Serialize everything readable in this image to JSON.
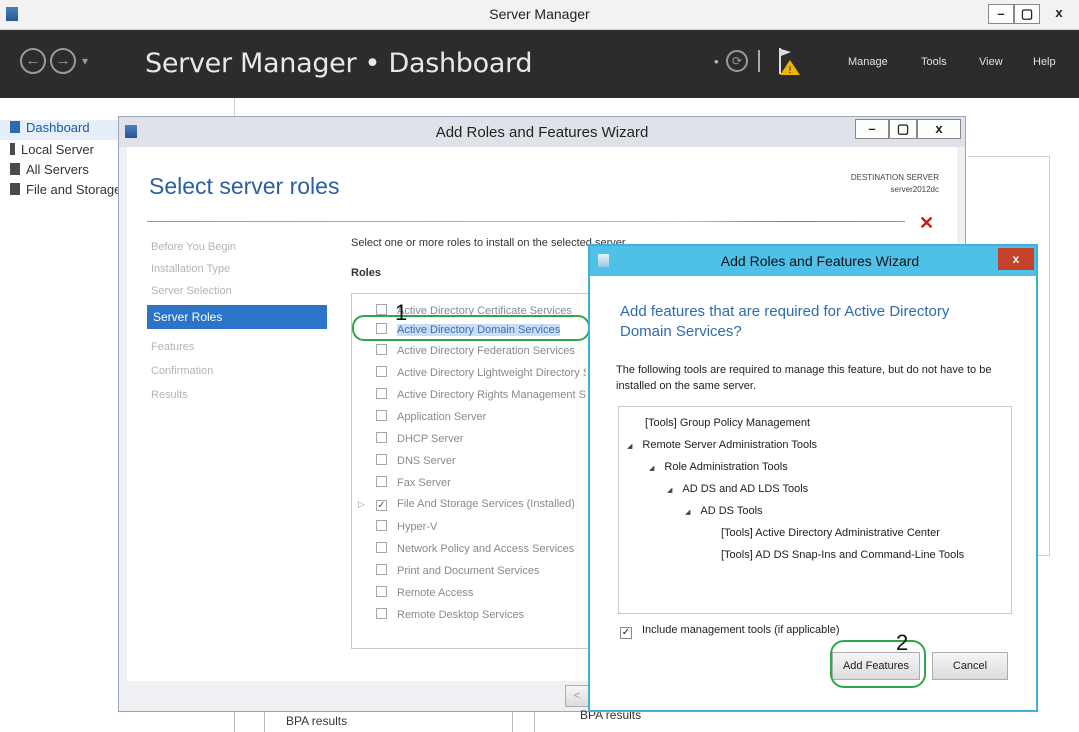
{
  "window": {
    "title": "Server Manager",
    "controls": [
      "–",
      "▢",
      "x"
    ]
  },
  "header": {
    "breadcrumb": "Server Manager • Dashboard",
    "menu": [
      "Manage",
      "Tools",
      "View",
      "Help"
    ]
  },
  "sidebar": {
    "items": [
      {
        "label": "Dashboard"
      },
      {
        "label": "Local Server"
      },
      {
        "label": "All Servers"
      },
      {
        "label": "File and Storage Services"
      }
    ]
  },
  "wizard": {
    "title": "Add Roles and Features Wizard",
    "controls": [
      "–",
      "▢",
      "x"
    ],
    "heading": "Select server roles",
    "destination_label": "DESTINATION SERVER",
    "destination_server": "server2012dc",
    "steps": [
      "Before You Begin",
      "Installation Type",
      "Server Selection",
      "Server Roles",
      "Features",
      "Confirmation",
      "Results"
    ],
    "active_step": "Server Roles",
    "instruction": "Select one or more roles to install on the selected server.",
    "roles_header": "Roles",
    "roles": [
      {
        "label": "Active Directory Certificate Services",
        "checked": false
      },
      {
        "label": "Active Directory Domain Services",
        "checked": false,
        "selected": true
      },
      {
        "label": "Active Directory Federation Services",
        "checked": false
      },
      {
        "label": "Active Directory Lightweight Directory Services",
        "checked": false
      },
      {
        "label": "Active Directory Rights Management Services",
        "checked": false
      },
      {
        "label": "Application Server",
        "checked": false
      },
      {
        "label": "DHCP Server",
        "checked": false
      },
      {
        "label": "DNS Server",
        "checked": false
      },
      {
        "label": "Fax Server",
        "checked": false
      },
      {
        "label": "File And Storage Services (Installed)",
        "checked": true,
        "expandable": true
      },
      {
        "label": "Hyper-V",
        "checked": false
      },
      {
        "label": "Network Policy and Access Services",
        "checked": false
      },
      {
        "label": "Print and Document Services",
        "checked": false
      },
      {
        "label": "Remote Access",
        "checked": false
      },
      {
        "label": "Remote Desktop Services",
        "checked": false
      }
    ],
    "footer_prev": "<"
  },
  "dialog": {
    "title": "Add Roles and Features Wizard",
    "close": "x",
    "question": "Add features that are required for Active Directory Domain Services?",
    "description": "The following tools are required to manage this feature, but do not have to be installed on the same server.",
    "tree": [
      {
        "label": "[Tools] Group Policy Management",
        "level": 0,
        "expanded": null
      },
      {
        "label": "Remote Server Administration Tools",
        "level": 0,
        "expanded": true
      },
      {
        "label": "Role Administration Tools",
        "level": 1,
        "expanded": true
      },
      {
        "label": "AD DS and AD LDS Tools",
        "level": 2,
        "expanded": true
      },
      {
        "label": "AD DS Tools",
        "level": 3,
        "expanded": true
      },
      {
        "label": "[Tools] Active Directory Administrative Center",
        "level": 4,
        "expanded": null
      },
      {
        "label": "[Tools] AD DS Snap-Ins and Command-Line Tools",
        "level": 4,
        "expanded": null
      }
    ],
    "include_label": "Include management tools (if applicable)",
    "include_checked": true,
    "add_button": "Add Features",
    "cancel_button": "Cancel"
  },
  "annotations": {
    "step1": "1",
    "step2": "2"
  },
  "bottom": {
    "bpa_left": "BPA results",
    "bpa_right": "BPA results"
  }
}
